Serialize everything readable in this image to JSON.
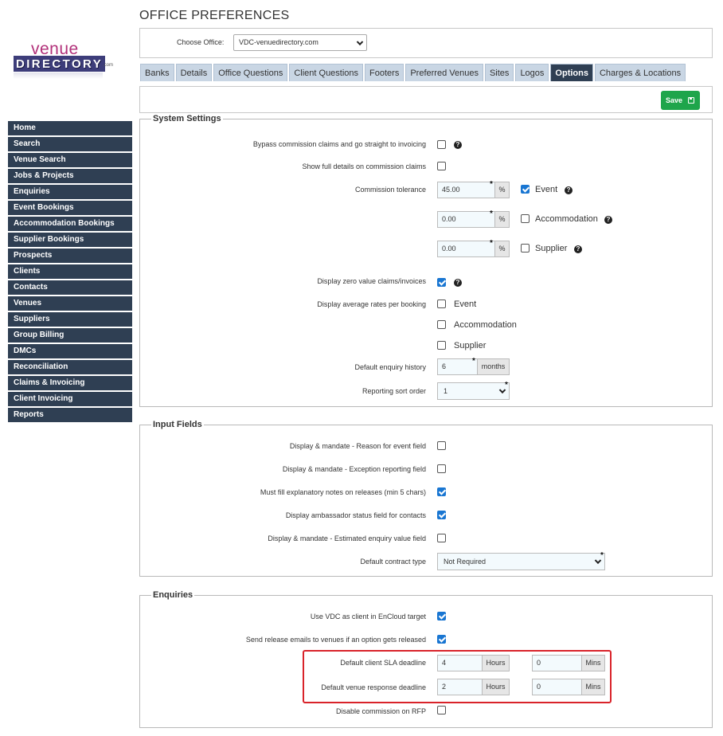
{
  "header": {
    "title": "OFFICE PREFERENCES"
  },
  "logo": {
    "line1": "venue",
    "line2": "DIRECTORY",
    "suffix": ".com"
  },
  "office": {
    "label": "Choose Office:",
    "selected": "VDC-venuedirectory.com"
  },
  "tabs": [
    "Banks",
    "Details",
    "Office Questions",
    "Client Questions",
    "Footers",
    "Preferred Venues",
    "Sites",
    "Logos",
    "Options",
    "Charges & Locations"
  ],
  "active_tab": "Options",
  "toolbar": {
    "save_label": "Save"
  },
  "sidebar": {
    "items": [
      "Home",
      "Search",
      "Venue Search",
      "Jobs & Projects",
      "Enquiries",
      "Event Bookings",
      "Accommodation Bookings",
      "Supplier Bookings",
      "Prospects",
      "Clients",
      "Contacts",
      "Venues",
      "Suppliers",
      "Group Billing",
      "DMCs",
      "Reconciliation",
      "Claims & Invoicing",
      "Client Invoicing",
      "Reports"
    ]
  },
  "system_settings": {
    "legend": "System Settings",
    "bypass_label": "Bypass commission claims and go straight to invoicing",
    "bypass_checked": false,
    "full_details_label": "Show full details on commission claims",
    "full_details_checked": false,
    "commission_label": "Commission tolerance",
    "tolerances": [
      {
        "value": "45.00",
        "unit": "%",
        "name": "Event",
        "checked": true
      },
      {
        "value": "0.00",
        "unit": "%",
        "name": "Accommodation",
        "checked": false
      },
      {
        "value": "0.00",
        "unit": "%",
        "name": "Supplier",
        "checked": false
      }
    ],
    "zero_value_label": "Display zero value claims/invoices",
    "zero_value_checked": true,
    "avg_rates_label": "Display average rates per booking",
    "avg_rates": [
      {
        "name": "Event",
        "checked": false
      },
      {
        "name": "Accommodation",
        "checked": false
      },
      {
        "name": "Supplier",
        "checked": false
      }
    ],
    "enquiry_history_label": "Default enquiry history",
    "enquiry_history_value": "6",
    "enquiry_history_unit": "months",
    "sort_order_label": "Reporting sort order",
    "sort_order_value": "1"
  },
  "input_fields": {
    "legend": "Input Fields",
    "reason_label": "Display & mandate - Reason for event field",
    "reason_checked": false,
    "exception_label": "Display & mandate - Exception reporting field",
    "exception_checked": false,
    "notes_label": "Must fill explanatory notes on releases (min 5 chars)",
    "notes_checked": true,
    "ambassador_label": "Display ambassador status field for contacts",
    "ambassador_checked": true,
    "estimated_label": "Display & mandate - Estimated enquiry value field",
    "estimated_checked": false,
    "contract_label": "Default contract type",
    "contract_value": "Not Required"
  },
  "enquiries": {
    "legend": "Enquiries",
    "vdc_label": "Use VDC as client in EnCloud target",
    "vdc_checked": true,
    "release_label": "Send release emails to venues if an option gets released",
    "release_checked": true,
    "client_sla_label": "Default client SLA deadline",
    "client_sla_hours": "4",
    "client_sla_mins": "0",
    "venue_response_label": "Default venue response deadline",
    "venue_response_hours": "2",
    "venue_response_mins": "0",
    "hours_unit": "Hours",
    "mins_unit": "Mins",
    "disable_rfp_label": "Disable commission on RFP",
    "disable_rfp_checked": false
  },
  "colors": {
    "nav_bg": "#2f3f53",
    "tab_bg": "#c9d6e4",
    "save_green": "#1ea54b",
    "checkbox_blue": "#1976d2",
    "highlight_red": "#d9232a"
  }
}
